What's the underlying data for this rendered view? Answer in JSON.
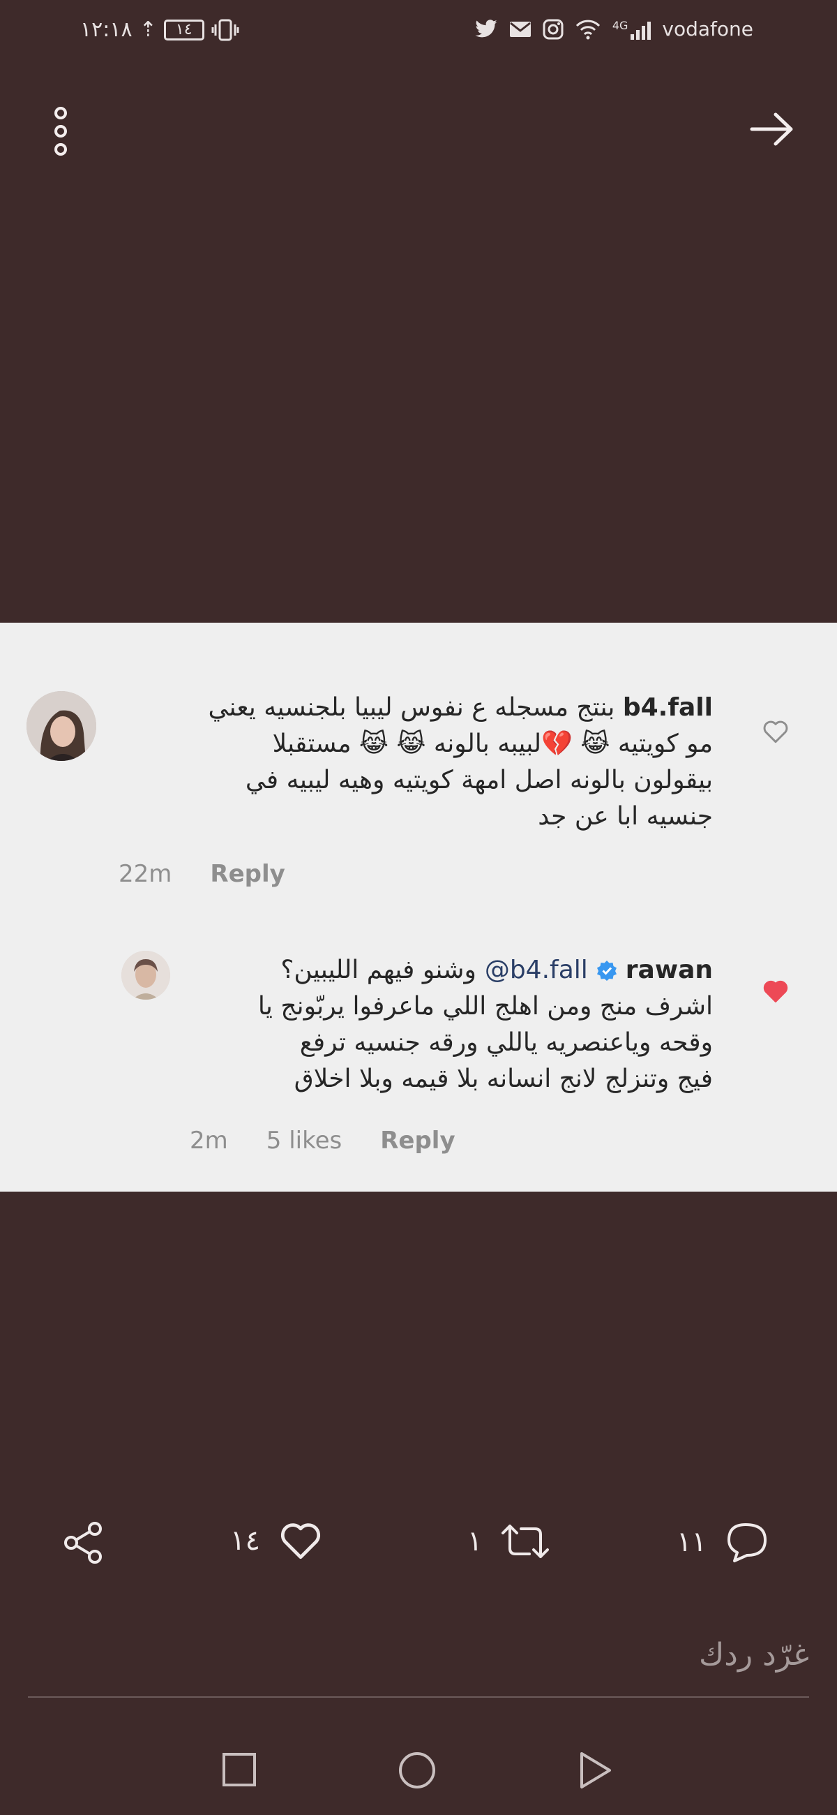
{
  "status_bar": {
    "time": "١٢:١٨",
    "battery": "١٤",
    "network": "4G",
    "carrier": "vodafone"
  },
  "comments": [
    {
      "username": "b4.fall",
      "lines": [
        "بنتج مسجله ع نفوس ليبيا بلجنسيه يعني",
        "مو كويتيه 😹 💔لبيبه بالونه 😹 😹 مستقبلا",
        "بيقولون بالونه اصل امهة كويتيه وهيه ليبيه في",
        "جنسيه ابا عن جد"
      ],
      "time": "22m",
      "reply_label": "Reply",
      "liked": false
    },
    {
      "username": "rawan",
      "verified": true,
      "mention": "@b4.fall",
      "lines": [
        "وشنو فيهم الليبين؟",
        "اشرف منج ومن اهلج اللي ماعرفوا يربّونج يا",
        "وقحه وياعنصريه ياللي ورقه جنسيه ترفع",
        "فيج وتنزلج لانج انسانه بلا قيمه وبلا اخلاق"
      ],
      "time": "2m",
      "likes": "5 likes",
      "reply_label": "Reply",
      "liked": true
    }
  ],
  "actions": {
    "likes_count": "١٤",
    "retweets_count": "١",
    "replies_count": "١١"
  },
  "reply_field": {
    "placeholder": "غرّد ردك"
  },
  "colors": {
    "background": "#3e2a2a",
    "panel": "#efefef",
    "heart_red": "#ed4956",
    "verified_blue": "#3897f0"
  }
}
